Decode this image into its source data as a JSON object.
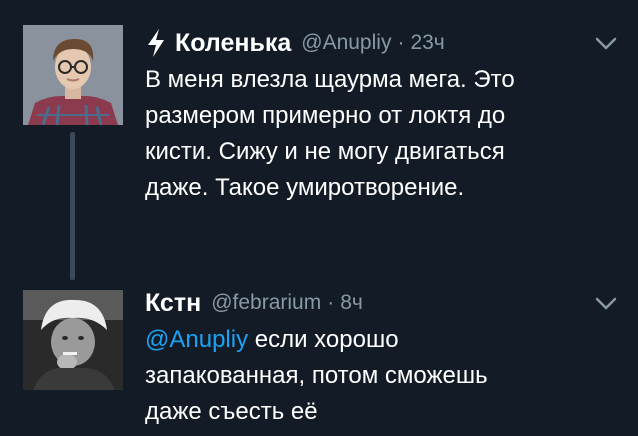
{
  "tweets": [
    {
      "author": {
        "name": "Коленька",
        "handle": "@Anupliy"
      },
      "separator": "·",
      "time": "23ч",
      "badge_icon": "lightning-icon",
      "text_lines": [
        "В меня влезла щаурма мега. Это",
        "размером примерно от локтя до",
        "кисти. Сижу и не могу двигаться",
        "даже. Такое умиротворение."
      ]
    },
    {
      "author": {
        "name": "Кстн",
        "handle": "@febrarium"
      },
      "separator": "·",
      "time": "8ч",
      "mention": "@Anupliy",
      "text_lines": [
        " если хорошо",
        "запакованная, потом сможешь",
        "даже съесть её"
      ]
    }
  ],
  "colors": {
    "background": "#131C26",
    "secondary_text": "#8899A6",
    "mention": "#1DA1F2",
    "thread_line": "#3A4A5B"
  }
}
